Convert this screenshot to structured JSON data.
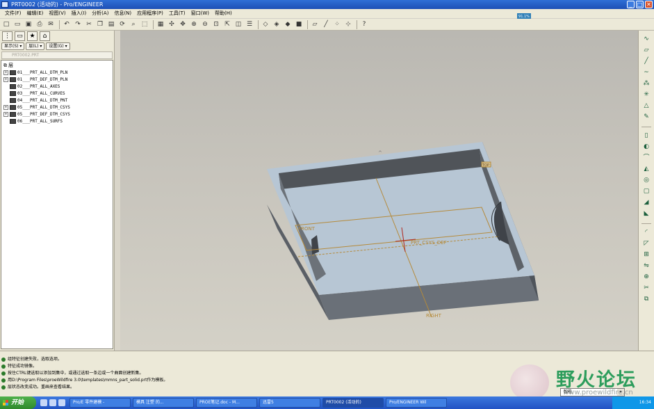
{
  "window": {
    "title": "PRT0002 (活动的) - Pro/ENGINEER"
  },
  "menu": {
    "items": [
      "文件(F)",
      "编辑(E)",
      "视图(V)",
      "插入(I)",
      "分析(A)",
      "信息(N)",
      "应用程序(P)",
      "工具(T)",
      "窗口(W)",
      "帮助(H)"
    ]
  },
  "status_mini": "91.1%",
  "toolbar": {
    "icons": [
      "new-icon",
      "open-icon",
      "save-icon",
      "print-icon",
      "email-icon",
      "undo-icon",
      "redo-icon",
      "cut-icon",
      "copy-icon",
      "paste-icon",
      "regenerate-icon",
      "find-icon",
      "select-box-icon",
      "repaint-icon",
      "spin-center-icon",
      "orient-icon",
      "zoom-in-icon",
      "zoom-out-icon",
      "refit-icon",
      "reorient-icon",
      "saved-views-icon",
      "layers-icon",
      "wireframe-icon",
      "hidden-line-icon",
      "no-hidden-icon",
      "shading-icon",
      "datum-plane-icon",
      "datum-axis-icon",
      "datum-point-icon",
      "coord-sys-icon",
      "help-icon"
    ]
  },
  "navigator": {
    "tabs": [
      "model-tree-tab-icon",
      "folder-tab-icon",
      "favorites-tab-icon",
      "connections-tab-icon"
    ],
    "buttons": [
      "显示(S)",
      "层(L)",
      "设置(G)"
    ],
    "model_field": "PRT0002.PRT",
    "root_label": "层",
    "layers": [
      {
        "label": "01___PRT_ALL_DTM_PLN",
        "expandable": true
      },
      {
        "label": "01___PRT_DEF_DTM_PLN",
        "expandable": true
      },
      {
        "label": "02___PRT_ALL_AXES",
        "expandable": false
      },
      {
        "label": "03___PRT_ALL_CURVES",
        "expandable": false
      },
      {
        "label": "04___PRT_ALL_DTM_PNT",
        "expandable": false
      },
      {
        "label": "05___PRT_ALL_DTM_CSYS",
        "expandable": true
      },
      {
        "label": "05___PRT_DEF_DTM_CSYS",
        "expandable": true
      },
      {
        "label": "06___PRT_ALL_SURFS",
        "expandable": false
      }
    ]
  },
  "viewport": {
    "labels": {
      "front": "FRONT",
      "csys": "PRT_CSYS_DEF",
      "right": "RIGHT",
      "top": "TOP"
    },
    "colors": {
      "top_face": "#b7c6d4",
      "wall_dark": "#5a5f66",
      "wall_mid": "#747a82",
      "datum": "#b58a3a",
      "csys": "#b0281e"
    }
  },
  "rightbar": {
    "icons": [
      "sketch-icon",
      "plane-icon",
      "axis-icon",
      "curve-icon",
      "point-icon",
      "csys-icon",
      "analysis-icon",
      "sketch-tool-icon",
      "extrude-icon",
      "revolve-icon",
      "sweep-icon",
      "blend-icon",
      "hole-icon",
      "shell-icon",
      "rib-icon",
      "draft-icon",
      "round-icon",
      "chamfer-icon",
      "pattern-icon",
      "mirror-icon",
      "merge-icon",
      "trim-icon",
      "offset-icon",
      "thicken-icon",
      "solidify-icon"
    ]
  },
  "messages": [
    "组特征创建失败，选取选项。",
    "特征成功镜像。",
    "按住CTRL键选取以添加到集中，或通过选取一条边或一个曲面创建新集。",
    "用D:\\Program Files\\proeWildfire 3.0\\templates\\mmns_part_solid.prt作为模板。",
    "层状态改变成功。重画来查看结果。"
  ],
  "filter": {
    "value": "智能"
  },
  "watermark": {
    "text": "野火论坛",
    "url": "www.proewildfire.cn"
  },
  "taskbar": {
    "start_label": "开始",
    "tasks": [
      {
        "label": "Pro/E 零件建模 -",
        "active": false
      },
      {
        "label": "模具 注塑 的...",
        "active": false
      },
      {
        "label": "PROE笔记.doc - M...",
        "active": false
      },
      {
        "label": "迅雷5",
        "active": false
      },
      {
        "label": "PRT0002 (活动的)",
        "active": true
      },
      {
        "label": "Pro/ENGINEER Wil",
        "active": false
      }
    ],
    "clock": "16:34"
  }
}
